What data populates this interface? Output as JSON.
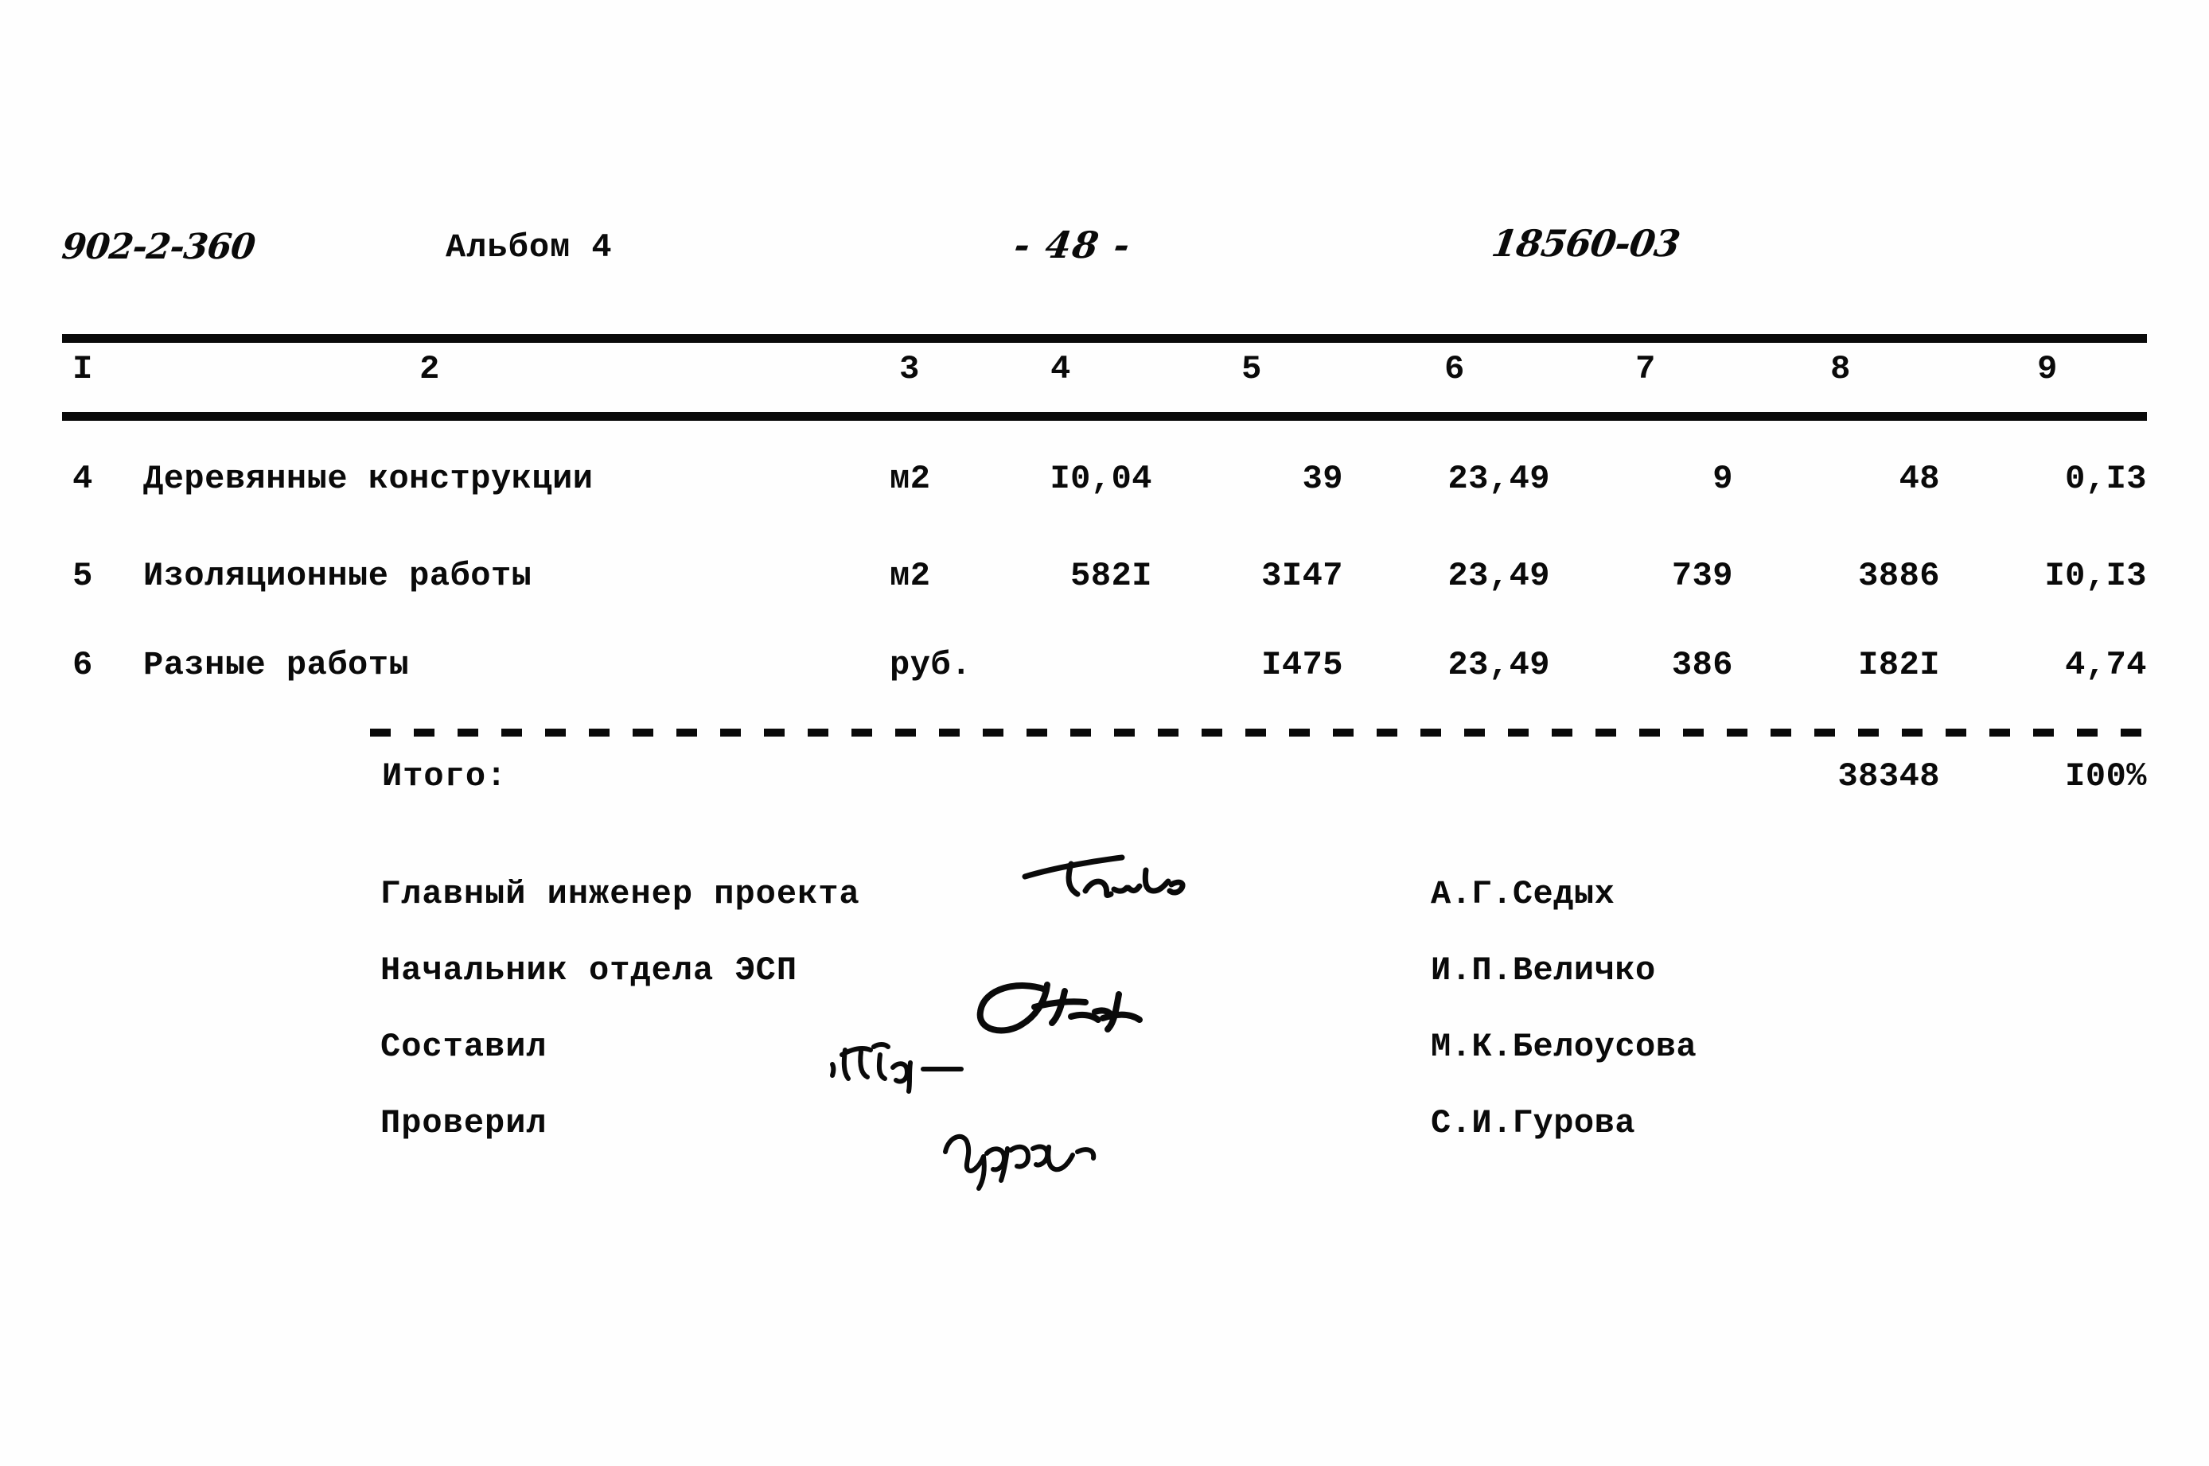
{
  "header": {
    "project_code": "902-2-360",
    "album": "Альбом 4",
    "page_marker": "- 48 -",
    "doc_number": "18560-03"
  },
  "table": {
    "column_headers": [
      "I",
      "2",
      "3",
      "4",
      "5",
      "6",
      "7",
      "8",
      "9"
    ],
    "rows": [
      {
        "num": "4",
        "name": "Деревянные конструкции",
        "unit": "м2",
        "c4": "I0,04",
        "c5": "39",
        "c6": "23,49",
        "c7": "9",
        "c8": "48",
        "c9": "0,I3"
      },
      {
        "num": "5",
        "name": "Изоляционные работы",
        "unit": "м2",
        "c4": "582I",
        "c5": "3I47",
        "c6": "23,49",
        "c7": "739",
        "c8": "3886",
        "c9": "I0,I3"
      },
      {
        "num": "6",
        "name": "Разные работы",
        "unit": "руб.",
        "c4": "",
        "c5": "I475",
        "c6": "23,49",
        "c7": "386",
        "c8": "I82I",
        "c9": "4,74"
      }
    ],
    "total": {
      "label": "Итого:",
      "c8": "38348",
      "c9": "I00%"
    }
  },
  "signatures": [
    {
      "role": "Главный инженер проекта",
      "name": "А.Г.Седых",
      "signed": true
    },
    {
      "role": "Начальник отдела ЭСП",
      "name": "И.П.Величко",
      "signed": true
    },
    {
      "role": "Составил",
      "name": "М.К.Белоусова",
      "signed": true
    },
    {
      "role": "Проверил",
      "name": "С.И.Гурова",
      "signed": true
    }
  ]
}
